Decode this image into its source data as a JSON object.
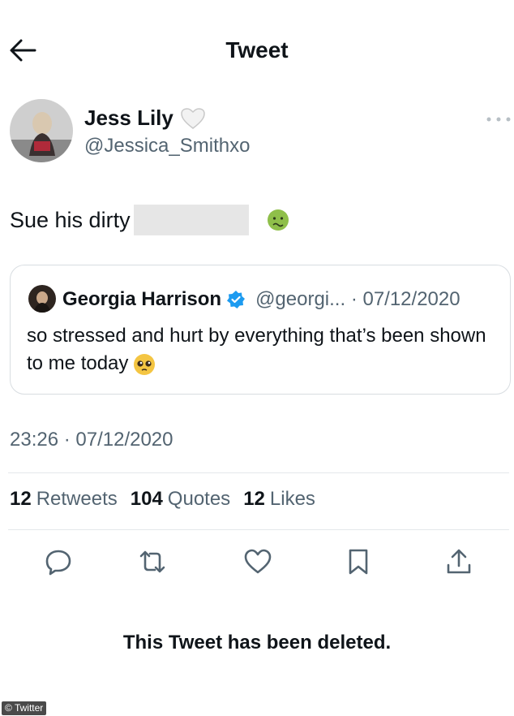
{
  "header": {
    "title": "Tweet"
  },
  "tweet": {
    "author_name": "Jess Lily",
    "author_handle": "@Jessica_Smithxo",
    "text": "Sue his dirty",
    "timestamp": "23:26 · 07/12/2020"
  },
  "quote": {
    "author_name": "Georgia Harrison",
    "handle_date": "@georgi... · 07/12/2020",
    "text": "so stressed and hurt by everything that’s been shown to me today"
  },
  "stats": [
    {
      "count": "12",
      "label": "Retweets"
    },
    {
      "count": "104",
      "label": "Quotes"
    },
    {
      "count": "12",
      "label": "Likes"
    }
  ],
  "deleted_notice": "This Tweet has been deleted.",
  "credit": "© Twitter",
  "colors": {
    "verified": "#1d9bf0",
    "secondary_text": "#536471",
    "redaction": "#e6e6e6"
  },
  "icons": [
    "back-arrow-icon",
    "white-heart-icon",
    "more-icon",
    "nauseated-face-emoji",
    "verified-badge-icon",
    "pleading-face-emoji",
    "reply-icon",
    "retweet-icon",
    "like-icon",
    "bookmark-icon",
    "share-icon"
  ]
}
